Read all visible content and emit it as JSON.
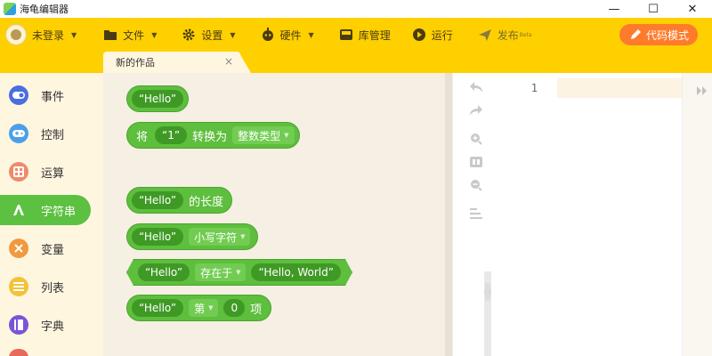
{
  "window": {
    "title": "海龟编辑器",
    "controls": {
      "minimize": "—",
      "maximize": "☐",
      "close": "✕"
    }
  },
  "toolbar": {
    "user_label": "未登录",
    "file_label": "文件",
    "settings_label": "设置",
    "hardware_label": "硬件",
    "library_label": "库管理",
    "run_label": "运行",
    "publish_label": "发布",
    "publish_badge": "Beta",
    "code_mode_label": "代码模式"
  },
  "tab": {
    "title": "新的作品",
    "close": "×"
  },
  "sidebar": {
    "items": [
      {
        "label": "事件",
        "icon": "toggle-icon",
        "color": "#4a6ee0"
      },
      {
        "label": "控制",
        "icon": "gamepad-icon",
        "color": "#4aa0e8"
      },
      {
        "label": "运算",
        "icon": "calculator-icon",
        "color": "#ef8a6a"
      },
      {
        "label": "字符串",
        "icon": "letter-a-icon",
        "color": "#5cc040",
        "active": true
      },
      {
        "label": "变量",
        "icon": "variable-x-icon",
        "color": "#f09a3e"
      },
      {
        "label": "列表",
        "icon": "list-icon",
        "color": "#f2c23a"
      },
      {
        "label": "字典",
        "icon": "book-icon",
        "color": "#7a55d8"
      }
    ]
  },
  "blocks": {
    "b1": {
      "text": "“Hello”"
    },
    "b2": {
      "prefix": "将",
      "value": "“1”",
      "mid": "转换为",
      "dropdown": "整数类型"
    },
    "b3": {
      "value": "“Hello”",
      "suffix": "的长度"
    },
    "b4": {
      "value": "“Hello”",
      "dropdown": "小写字符"
    },
    "b5": {
      "value": "“Hello”",
      "dropdown": "存在于",
      "value2": "“Hello, World”"
    },
    "b6": {
      "value": "“Hello”",
      "dropdown": "第",
      "num": "0",
      "suffix": "项"
    }
  },
  "editor": {
    "line_numbers": [
      "1"
    ]
  },
  "colors": {
    "toolbar": "#ffd000",
    "block_green": "#5ebe3d",
    "code_mode": "#ff7b2c"
  }
}
